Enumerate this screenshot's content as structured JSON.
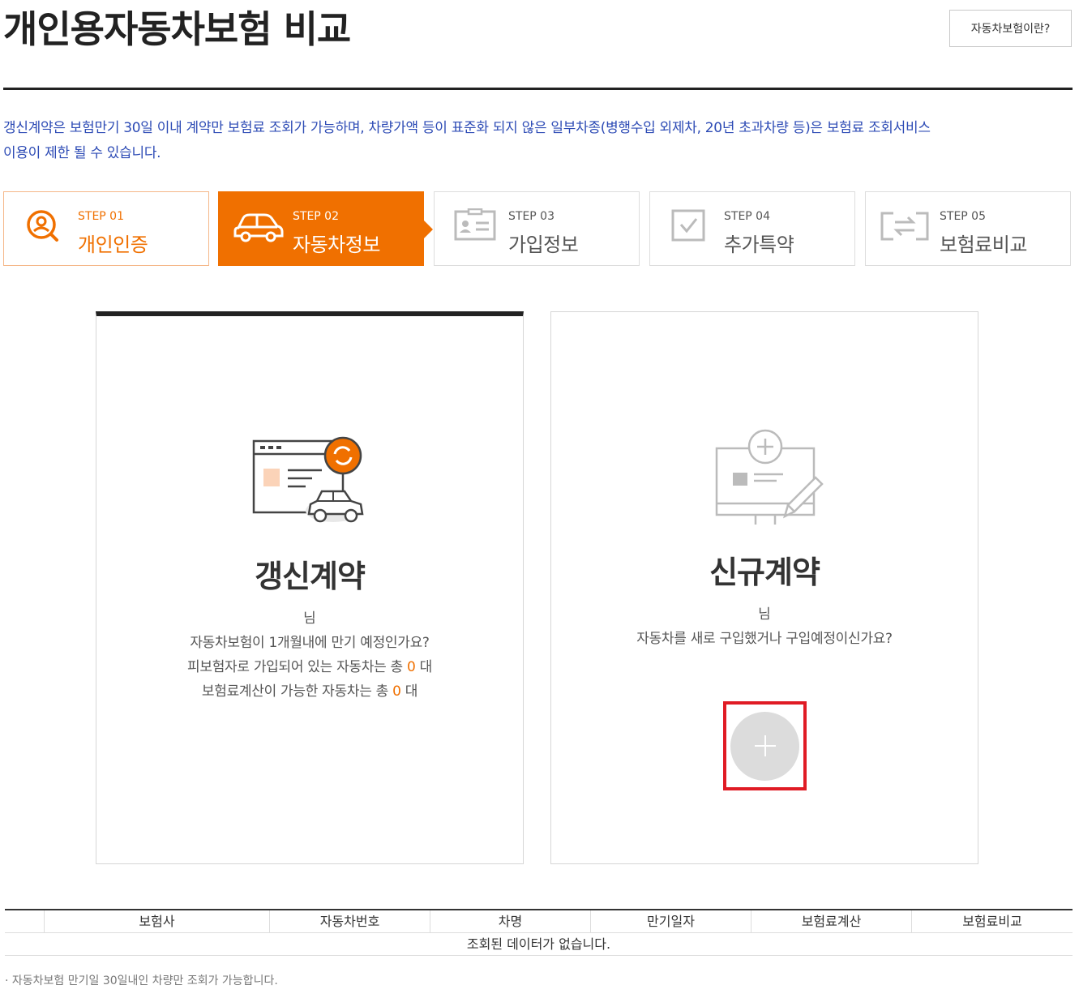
{
  "header": {
    "title": "개인용자동차보험 비교",
    "help_button": "자동차보험이란?"
  },
  "notice": {
    "line1": "갱신계약은 보험만기 30일 이내 계약만 보험료 조회가 가능하며, 차량가액 등이 표준화 되지 않은 일부차종(병행수입 외제차, 20년 초과차량 등)은 보험료 조회서비스",
    "line2": "이용이 제한 될 수 있습니다."
  },
  "steps": [
    {
      "num": "STEP 01",
      "label": "개인인증",
      "state": "done",
      "icon": "user-search-icon"
    },
    {
      "num": "STEP 02",
      "label": "자동차정보",
      "state": "active",
      "icon": "car-icon"
    },
    {
      "num": "STEP 03",
      "label": "가입정보",
      "state": "pending",
      "icon": "id-card-icon"
    },
    {
      "num": "STEP 04",
      "label": "추가특약",
      "state": "pending",
      "icon": "checkbox-icon"
    },
    {
      "num": "STEP 05",
      "label": "보험료비교",
      "state": "pending",
      "icon": "compare-arrows-icon"
    }
  ],
  "renewal": {
    "title": "갱신계약",
    "nim": "님",
    "line1": "자동차보험이 1개월내에 만기 예정인가요?",
    "line2_pre": "피보험자로 가입되어 있는 자동차는 총",
    "insured_count": "0",
    "line2_suf": "대",
    "line3_pre": "보험료계산이 가능한 자동차는 총",
    "calc_count": "0",
    "line3_suf": "대"
  },
  "new_contract": {
    "title": "신규계약",
    "nim": "님",
    "line1": "자동차를 새로 구입했거나 구입예정이신가요?",
    "add_symbol": "+"
  },
  "table": {
    "columns": [
      "",
      "보험사",
      "자동차번호",
      "차명",
      "만기일자",
      "보험료계산",
      "보험료비교"
    ],
    "empty_message": "조회된 데이터가 없습니다."
  },
  "footnote": "· 자동차보험 만기일 30일내인 차량만 조회가 가능합니다.",
  "colors": {
    "accent": "#f07000",
    "notice": "#2d4bb5",
    "highlight": "#e01b24"
  }
}
